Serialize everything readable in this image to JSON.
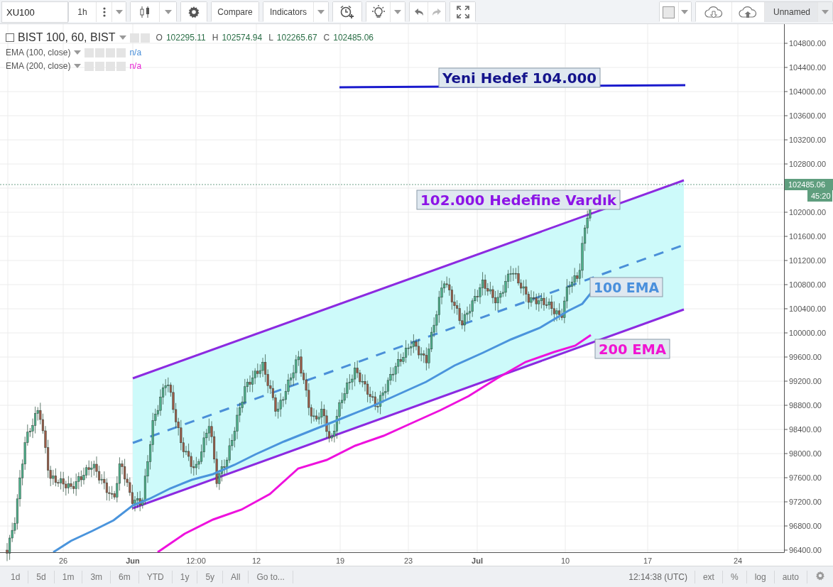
{
  "toolbar": {
    "symbol": "XU100",
    "interval": "1h",
    "compare": "Compare",
    "indicators": "Indicators",
    "layout_name": "Unnamed"
  },
  "legend": {
    "title": "BIST 100, 60, BIST",
    "ohlc": [
      {
        "label": "O",
        "value": "102295.11"
      },
      {
        "label": "H",
        "value": "102574.94"
      },
      {
        "label": "L",
        "value": "102265.67"
      },
      {
        "label": "C",
        "value": "102485.06"
      }
    ],
    "indicators": [
      {
        "name": "EMA (100, close)",
        "value": "n/a",
        "color": "#4a8fd8"
      },
      {
        "name": "EMA (200, close)",
        "value": "n/a",
        "color": "#e61ed2"
      }
    ]
  },
  "chart": {
    "annotations": [
      {
        "text": "Yeni Hedef 104.000",
        "color": "#14148c"
      },
      {
        "text": "102.000 Hedefine Vardık",
        "color": "#8c14e6"
      },
      {
        "text": "100 EMA",
        "color": "#4a90dc"
      },
      {
        "text": "200 EMA",
        "color": "#f014d2"
      }
    ],
    "price_axis": [
      "104800.00",
      "104400.00",
      "104000.00",
      "103600.00",
      "103200.00",
      "102800.00",
      "102000.00",
      "101600.00",
      "101200.00",
      "100800.00",
      "100400.00",
      "100000.00",
      "99600.00",
      "99200.00",
      "98800.00",
      "98400.00",
      "98000.00",
      "97600.00",
      "97200.00",
      "96800.00",
      "96400.00"
    ],
    "last_price": "102485.06",
    "countdown": "45:20",
    "time_axis": [
      "26",
      "Jun",
      "12:00",
      "12",
      "19",
      "23",
      "Jul",
      "10",
      "17",
      "24"
    ]
  },
  "bottom_bar": {
    "ranges": [
      "1d",
      "5d",
      "1m",
      "3m",
      "6m",
      "YTD",
      "1y",
      "5y",
      "All",
      "Go to..."
    ],
    "clock": "12:14:38 (UTC)",
    "options": [
      "ext",
      "%",
      "log",
      "auto"
    ]
  }
}
